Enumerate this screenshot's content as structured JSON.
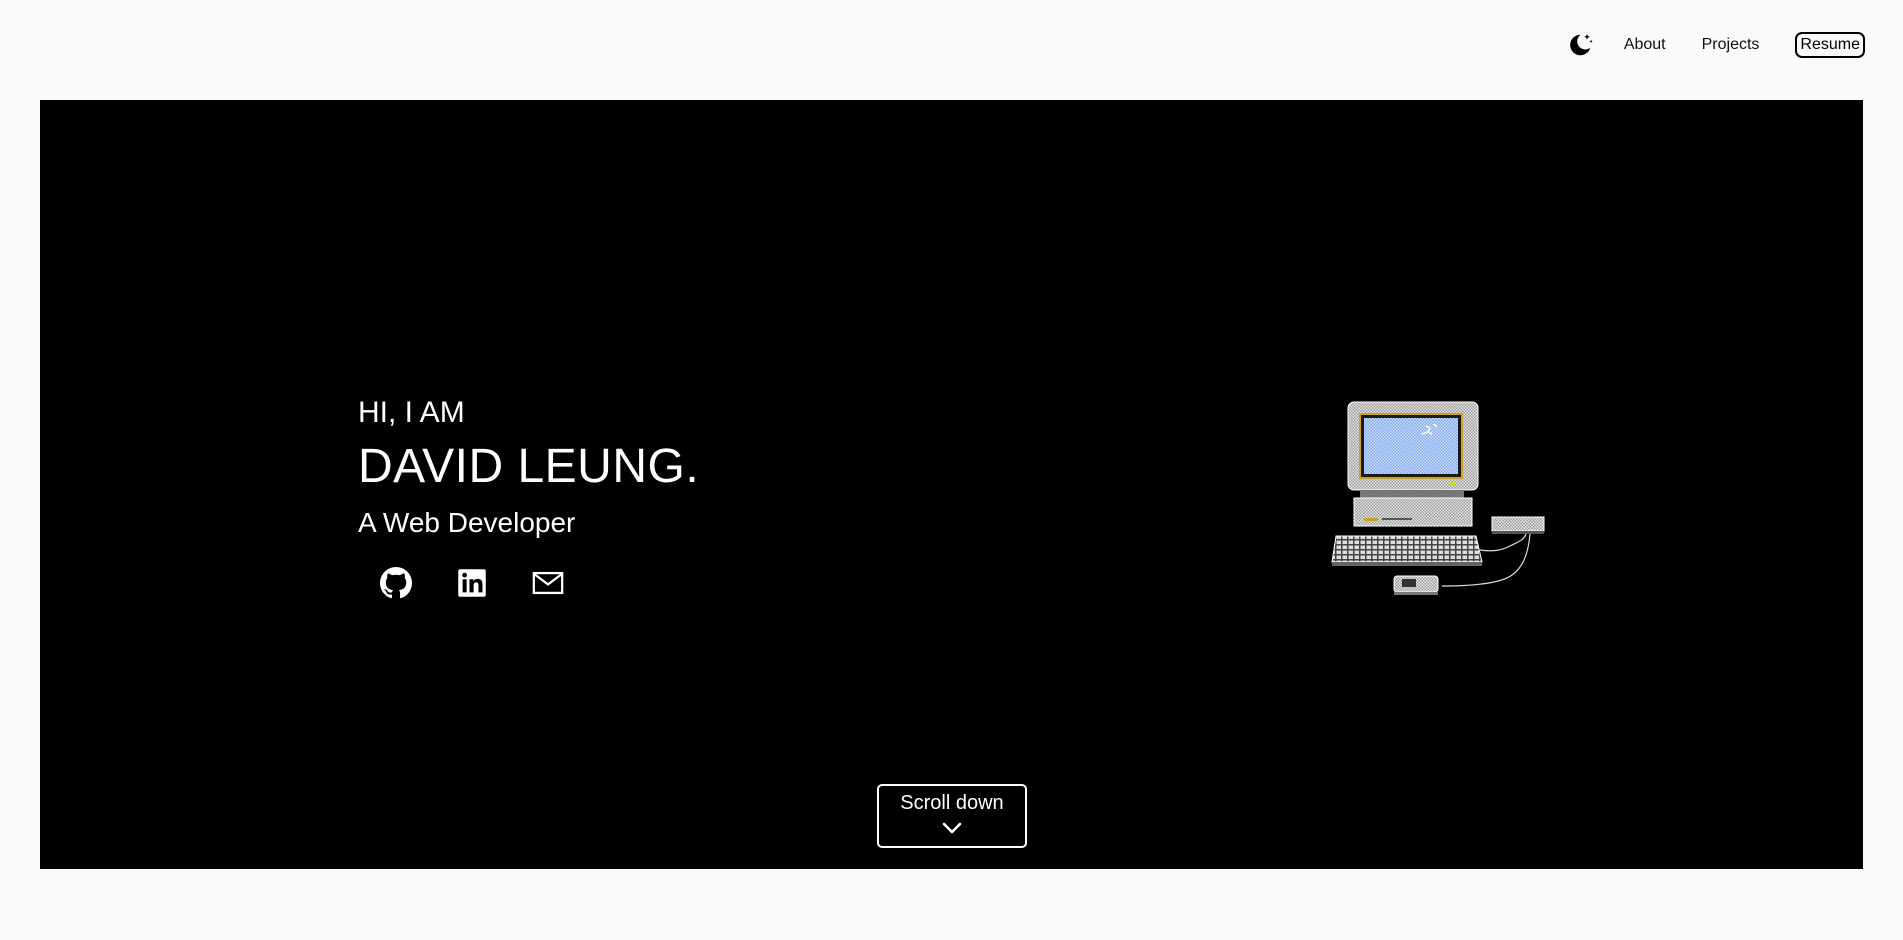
{
  "nav": {
    "theme_toggle_icon": "moon-stars-icon",
    "links": [
      {
        "label": "About"
      },
      {
        "label": "Projects"
      }
    ],
    "resume_label": "Resume"
  },
  "hero": {
    "greeting": "HI, I AM",
    "name": "DAVID LEUNG.",
    "role": "A Web Developer",
    "socials": [
      {
        "icon": "github-icon"
      },
      {
        "icon": "linkedin-icon"
      },
      {
        "icon": "mail-icon"
      }
    ],
    "illustration": "retro-computer-illustration",
    "scroll_label": "Scroll down",
    "scroll_icon": "chevron-down-icon"
  },
  "colors": {
    "page_background": "#f8fafc",
    "hero_background": "#000000",
    "hero_text": "#ffffff",
    "screen_blue": "#a8c8ff"
  }
}
